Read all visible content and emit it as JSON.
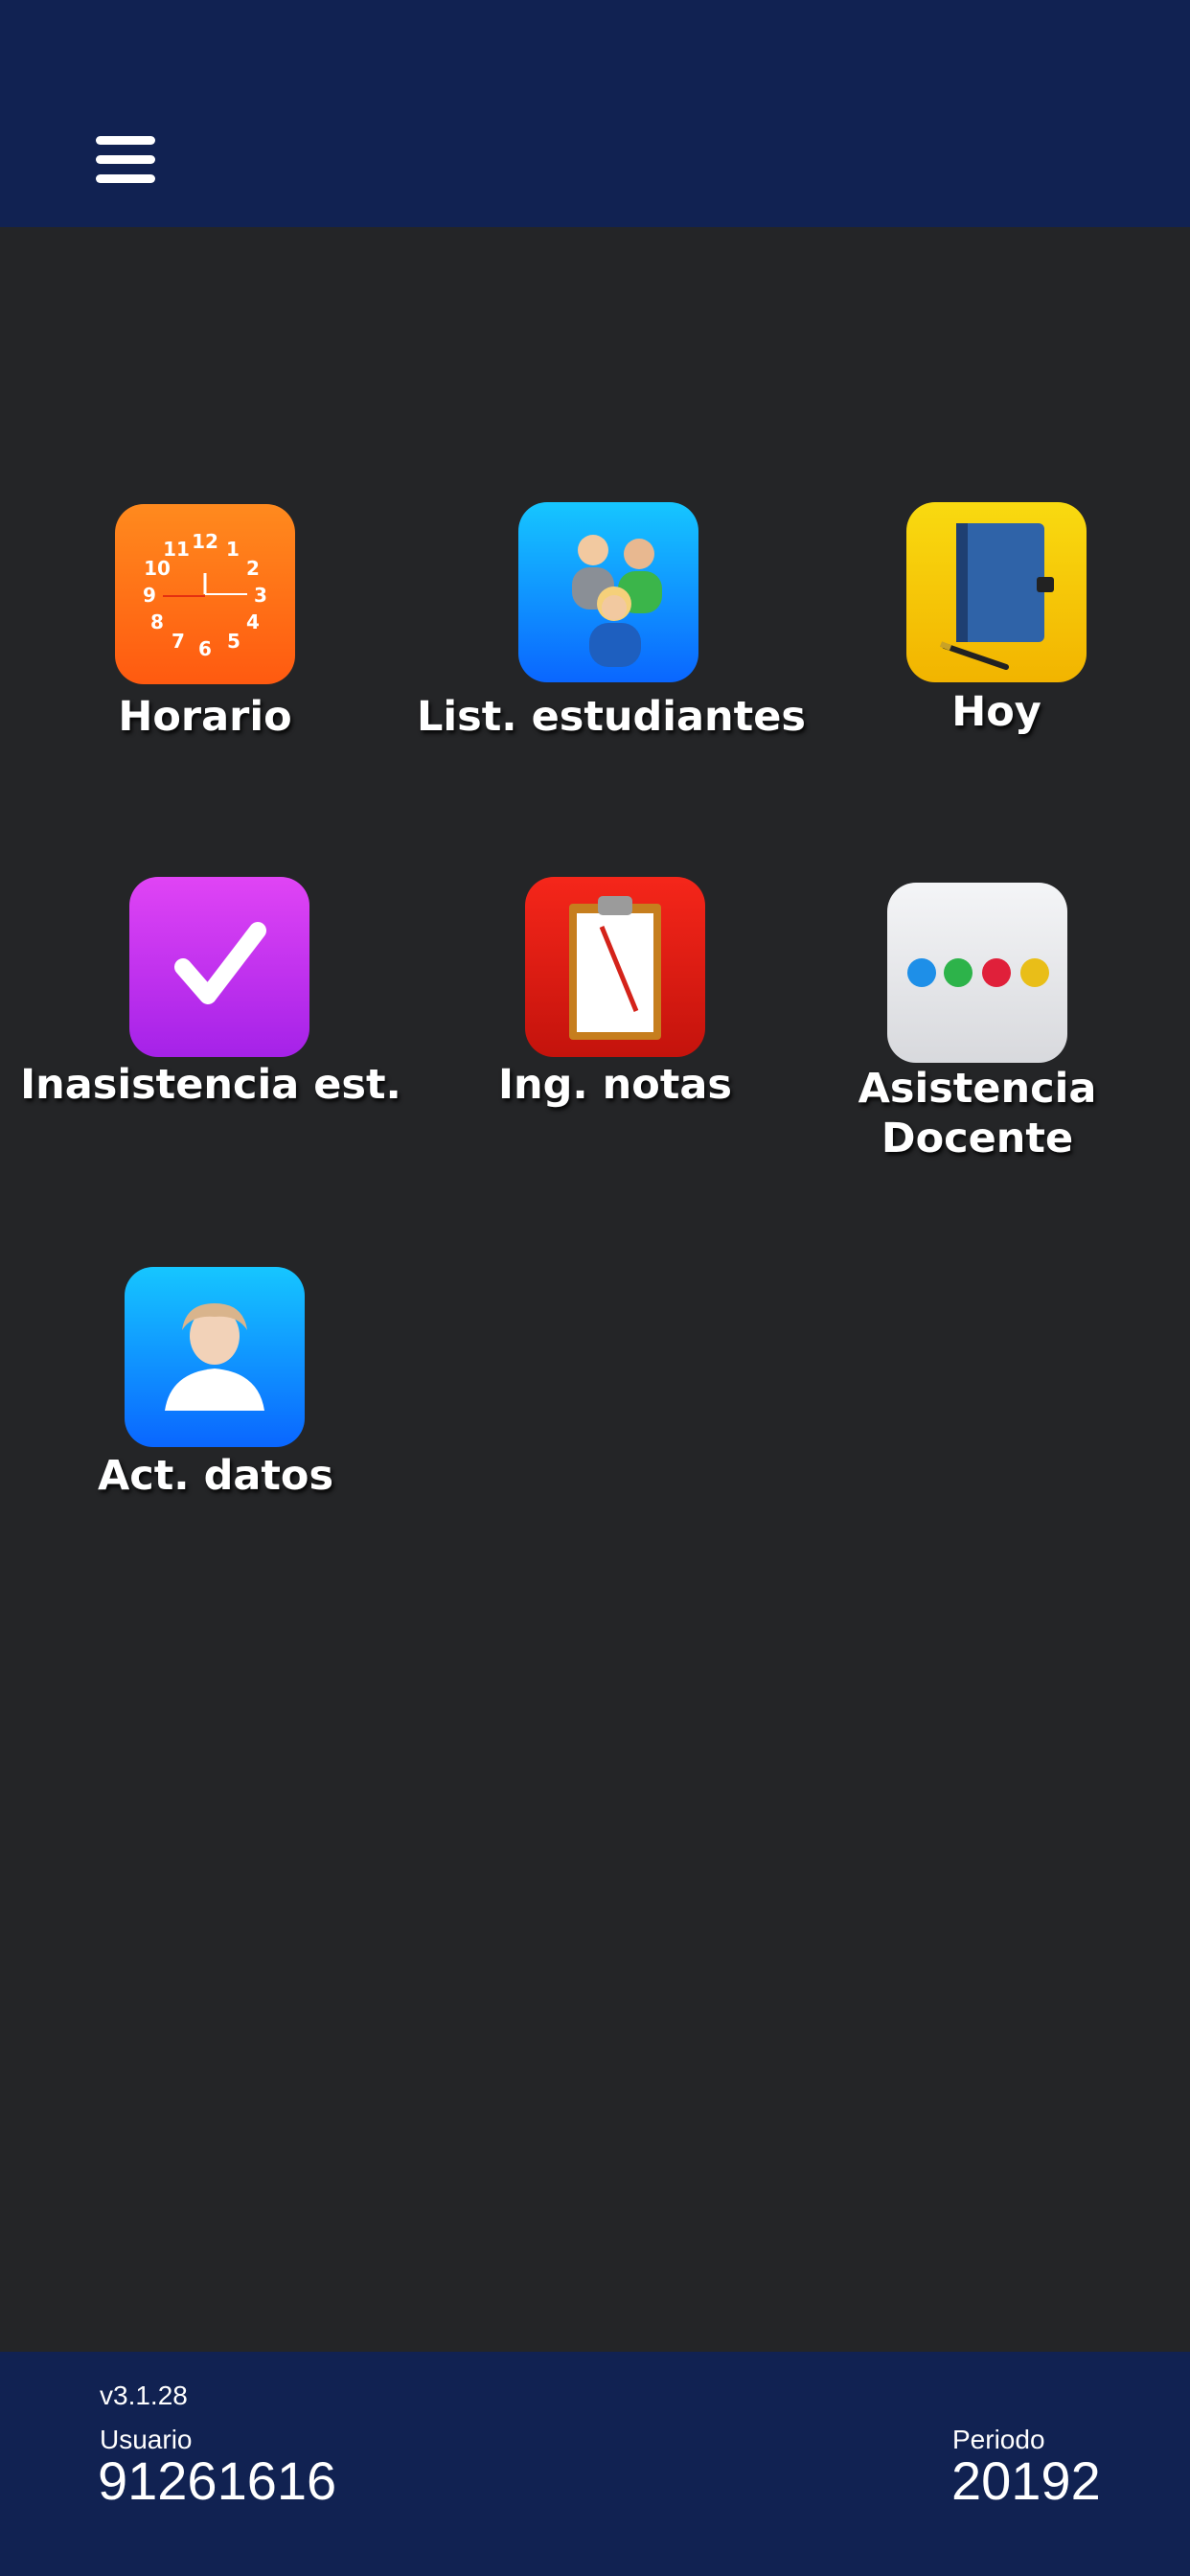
{
  "header": {
    "menu_icon": "hamburger-icon"
  },
  "tiles": [
    {
      "label": "Horario",
      "icon": "clock-icon",
      "color": "#FF6A1A"
    },
    {
      "label": "List. estudiantes",
      "icon": "students-group-icon",
      "color": "#0E8CFF"
    },
    {
      "label": "Hoy",
      "icon": "notebook-icon",
      "color": "#F5C800"
    },
    {
      "label": "Inasistencia est.",
      "icon": "checkmark-icon",
      "color": "#B32BF0"
    },
    {
      "label": "Ing. notas",
      "icon": "clipboard-icon",
      "color": "#E21A12"
    },
    {
      "label_line1": "Asistencia",
      "label_line2": "Docente",
      "icon": "color-dots-icon",
      "color": "#E9EAEE"
    },
    {
      "label": "Act. datos",
      "icon": "user-profile-icon",
      "color": "#0E8CFF"
    }
  ],
  "footer": {
    "version": "v3.1.28",
    "user_label": "Usuario",
    "user_value": "91261616",
    "period_label": "Periodo",
    "period_value": "20192"
  }
}
